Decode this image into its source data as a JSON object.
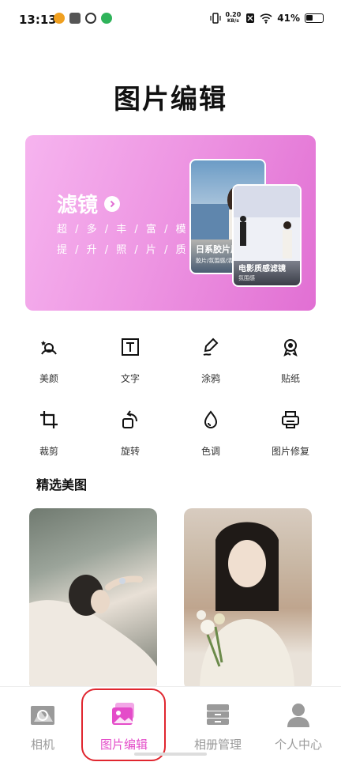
{
  "status": {
    "time": "13:13",
    "speed_value": "0.20",
    "speed_unit": "KB/s",
    "battery": "41%"
  },
  "page_title": "图片编辑",
  "banner": {
    "title": "滤镜",
    "line1": "超 / 多 / 丰 / 富 / 模 / 板",
    "line2": "提 / 升 / 照 / 片 / 质 / 感",
    "card1_label": "日系胶片风",
    "card1_sub": "胶片/氛围感/清",
    "card2_label": "电影质感滤镜",
    "card2_sub": "氛围感"
  },
  "tools": [
    {
      "label": "美颜",
      "icon": "beauty-icon"
    },
    {
      "label": "文字",
      "icon": "text-icon"
    },
    {
      "label": "涂鸦",
      "icon": "doodle-pen-icon"
    },
    {
      "label": "贴纸",
      "icon": "sticker-badge-icon"
    },
    {
      "label": "裁剪",
      "icon": "crop-icon"
    },
    {
      "label": "旋转",
      "icon": "rotate-icon"
    },
    {
      "label": "色调",
      "icon": "color-drop-icon"
    },
    {
      "label": "图片修复",
      "icon": "printer-repair-icon"
    }
  ],
  "section_title": "精选美图",
  "tabs": [
    {
      "label": "相机",
      "icon": "camera-aperture-icon"
    },
    {
      "label": "图片编辑",
      "icon": "image-edit-icon",
      "active": true
    },
    {
      "label": "相册管理",
      "icon": "album-drawer-icon"
    },
    {
      "label": "个人中心",
      "icon": "person-icon"
    }
  ],
  "colors": {
    "accent": "#e44cc9",
    "banner_start": "#f6b4ef",
    "banner_end": "#e16fd3",
    "highlight": "#e0262f"
  }
}
